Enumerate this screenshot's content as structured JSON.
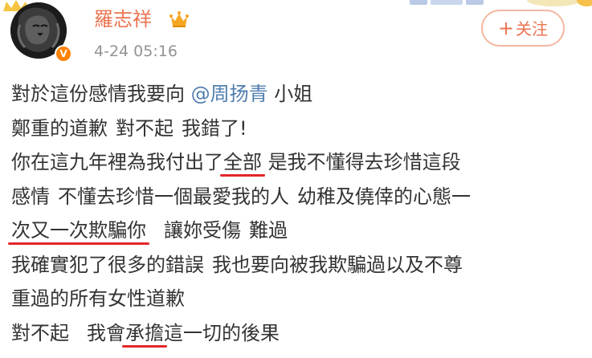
{
  "user": {
    "name": "羅志祥",
    "timestamp": "4-24 05:16",
    "verified_badge": "V"
  },
  "follow_button": {
    "plus": "+",
    "label": "关注"
  },
  "post": {
    "l1_text": "對於這份感情我要向 ",
    "l1_mention": "@周扬青",
    "l1_suffix": " 小姐",
    "l2_a": "鄭重的道歉",
    "l2_b": "對不起",
    "l2_c": "我錯了!",
    "l3_a": "你在這九年裡為我付出了",
    "l3_ul": "全部",
    "l3_b": " 是我不懂得去珍惜這段",
    "l4_a": "感情",
    "l4_b": "不懂去珍惜一個最愛我的人",
    "l4_c": "幼稚及僥倖的心態一",
    "l5_ul": "次又一次欺騙你",
    "l5_b": "讓妳受傷",
    "l5_c": "難過",
    "l6_a": "我確實犯了很多的錯誤",
    "l6_b": "我也要向被我欺騙過以及不尊",
    "l7": "重過的所有女性道歉",
    "l8_a": "對不起",
    "l8_b": "我會",
    "l8_ul": "承擔",
    "l8_c": "這一切的後果"
  },
  "colors": {
    "username": "#eb7350",
    "mention": "#507daf",
    "underline": "#e3262b",
    "verified": "#ff8200",
    "crown": "#f5a623",
    "timestamp": "#939393"
  },
  "icons": {
    "avatar": "lion-avatar",
    "crown": "crown-icon",
    "verified": "verified-v-badge"
  }
}
